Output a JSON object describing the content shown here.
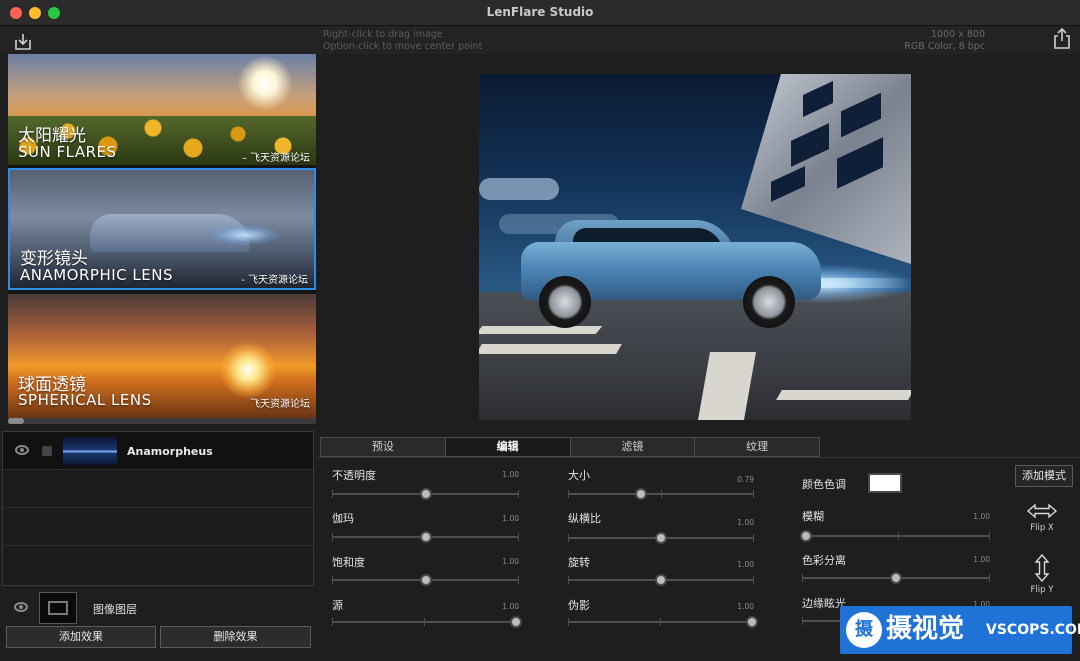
{
  "window": {
    "title": "LenFlare Studio"
  },
  "toolbar": {
    "hint_line1": "Right-click to drag image",
    "hint_line2": "Option-click to move center point",
    "image_size": "1000 x 800",
    "image_mode": "RGB Color, 8 bpc",
    "download_icon": "download-icon",
    "share_icon": "share-icon"
  },
  "presets": [
    {
      "cn": "太阳耀光",
      "en": "SUN FLARES",
      "watermark": "– 飞天资源论坛"
    },
    {
      "cn": "变形镜头",
      "en": "ANAMORPHIC LENS",
      "watermark": "- 飞天资源论坛",
      "selected": true
    },
    {
      "cn": "球面透镜",
      "en": "SPHERICAL LENS",
      "watermark": "飞天资源论坛"
    }
  ],
  "layers": {
    "items": [
      {
        "name": "Anamorpheus"
      }
    ],
    "image_layer": "图像图层",
    "add_effect": "添加效果",
    "delete_effect": "删除效果"
  },
  "tabs": [
    {
      "label": "预设"
    },
    {
      "label": "编辑",
      "active": true
    },
    {
      "label": "滤镜"
    },
    {
      "label": "纹理"
    }
  ],
  "sliders": {
    "opacity": {
      "label": "不透明度",
      "value": "1.00",
      "level": 0.5
    },
    "gamma": {
      "label": "伽玛",
      "value": "1.00",
      "level": 0.5
    },
    "saturation": {
      "label": "饱和度",
      "value": "1.00",
      "level": 0.5
    },
    "source": {
      "label": "源",
      "value": "1.00",
      "level": 1.0
    },
    "size": {
      "label": "大小",
      "value": "0.79",
      "level": 0.39
    },
    "aspect": {
      "label": "纵横比",
      "value": "1.00",
      "level": 0.5
    },
    "rotation": {
      "label": "旋转",
      "value": "1.00",
      "level": 0.5
    },
    "ghosts": {
      "label": "伪影",
      "value": "1.00",
      "level": 1.0
    },
    "blur": {
      "label": "模糊",
      "value": "1.00",
      "level": 0.0
    },
    "chroma": {
      "label": "色彩分离",
      "value": "1.00",
      "level": 0.5
    },
    "edge_glare": {
      "label": "边缘眩光",
      "value": "1.00",
      "level": 0.5
    }
  },
  "color_tint": {
    "label": "颜色色调",
    "color": "#ffffff"
  },
  "add_mode": "添加模式",
  "flip_x": "Flip X",
  "flip_y": "Flip Y",
  "watermark": {
    "logo": "摄",
    "cn": "摄视觉",
    "en": "VSCOPS.COM"
  },
  "colors": {
    "accent": "#2e8ce6",
    "background": "#1e1e1e",
    "watermark_bg": "#1f73d6"
  }
}
